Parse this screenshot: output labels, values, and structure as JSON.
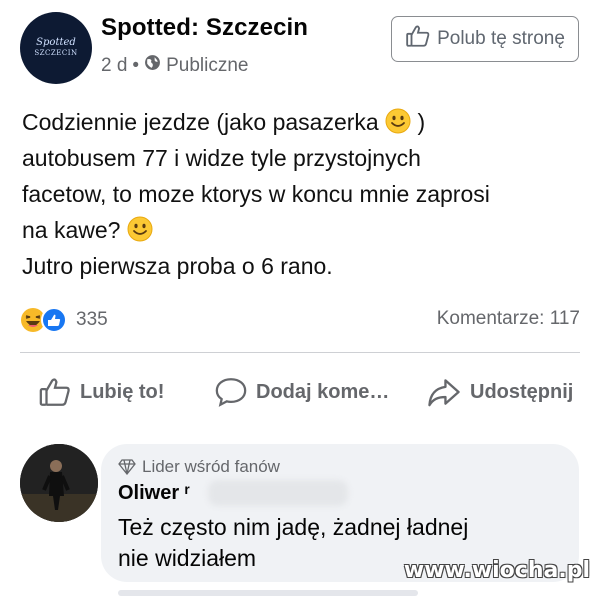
{
  "post": {
    "page_name": "Spotted: Szczecin",
    "time": "2 d",
    "separator": "•",
    "privacy": "Publiczne",
    "avatar_text": "Spotted",
    "avatar_subtext": "SZCZECIN",
    "like_page_label": "Polub tę stronę",
    "text_lines": [
      "Codziennie jezdze (jako pasazerka",
      ")",
      "autobusem 77 i widze tyle przystojnych",
      "facetow, to moze ktorys w koncu mnie zaprosi",
      "na kawe?",
      "Jutro pierwsza proba o 6 rano."
    ]
  },
  "stats": {
    "reactions_count": "335",
    "comments": "Komentarze: 117"
  },
  "actions": {
    "like": "Lubię to!",
    "comment": "Dodaj kome…",
    "share": "Udostępnij"
  },
  "comment": {
    "badge": "Lider wśród fanów",
    "author": "Oliwer ʳ",
    "text_lines": [
      "Też często nim jadę, żadnej ładnej",
      "nie widziałem"
    ]
  },
  "watermark": "www.wiocha.pl",
  "colors": {
    "like_blue": "#1877f2",
    "haha_yellow": "#f7b928",
    "muted": "#65676b",
    "bubble": "#f0f2f5"
  },
  "icons": [
    "globe-icon",
    "thumbs-up-icon",
    "smile-emoji",
    "haha-reaction-icon",
    "like-reaction-icon",
    "comment-icon",
    "share-icon",
    "diamond-badge-icon"
  ]
}
